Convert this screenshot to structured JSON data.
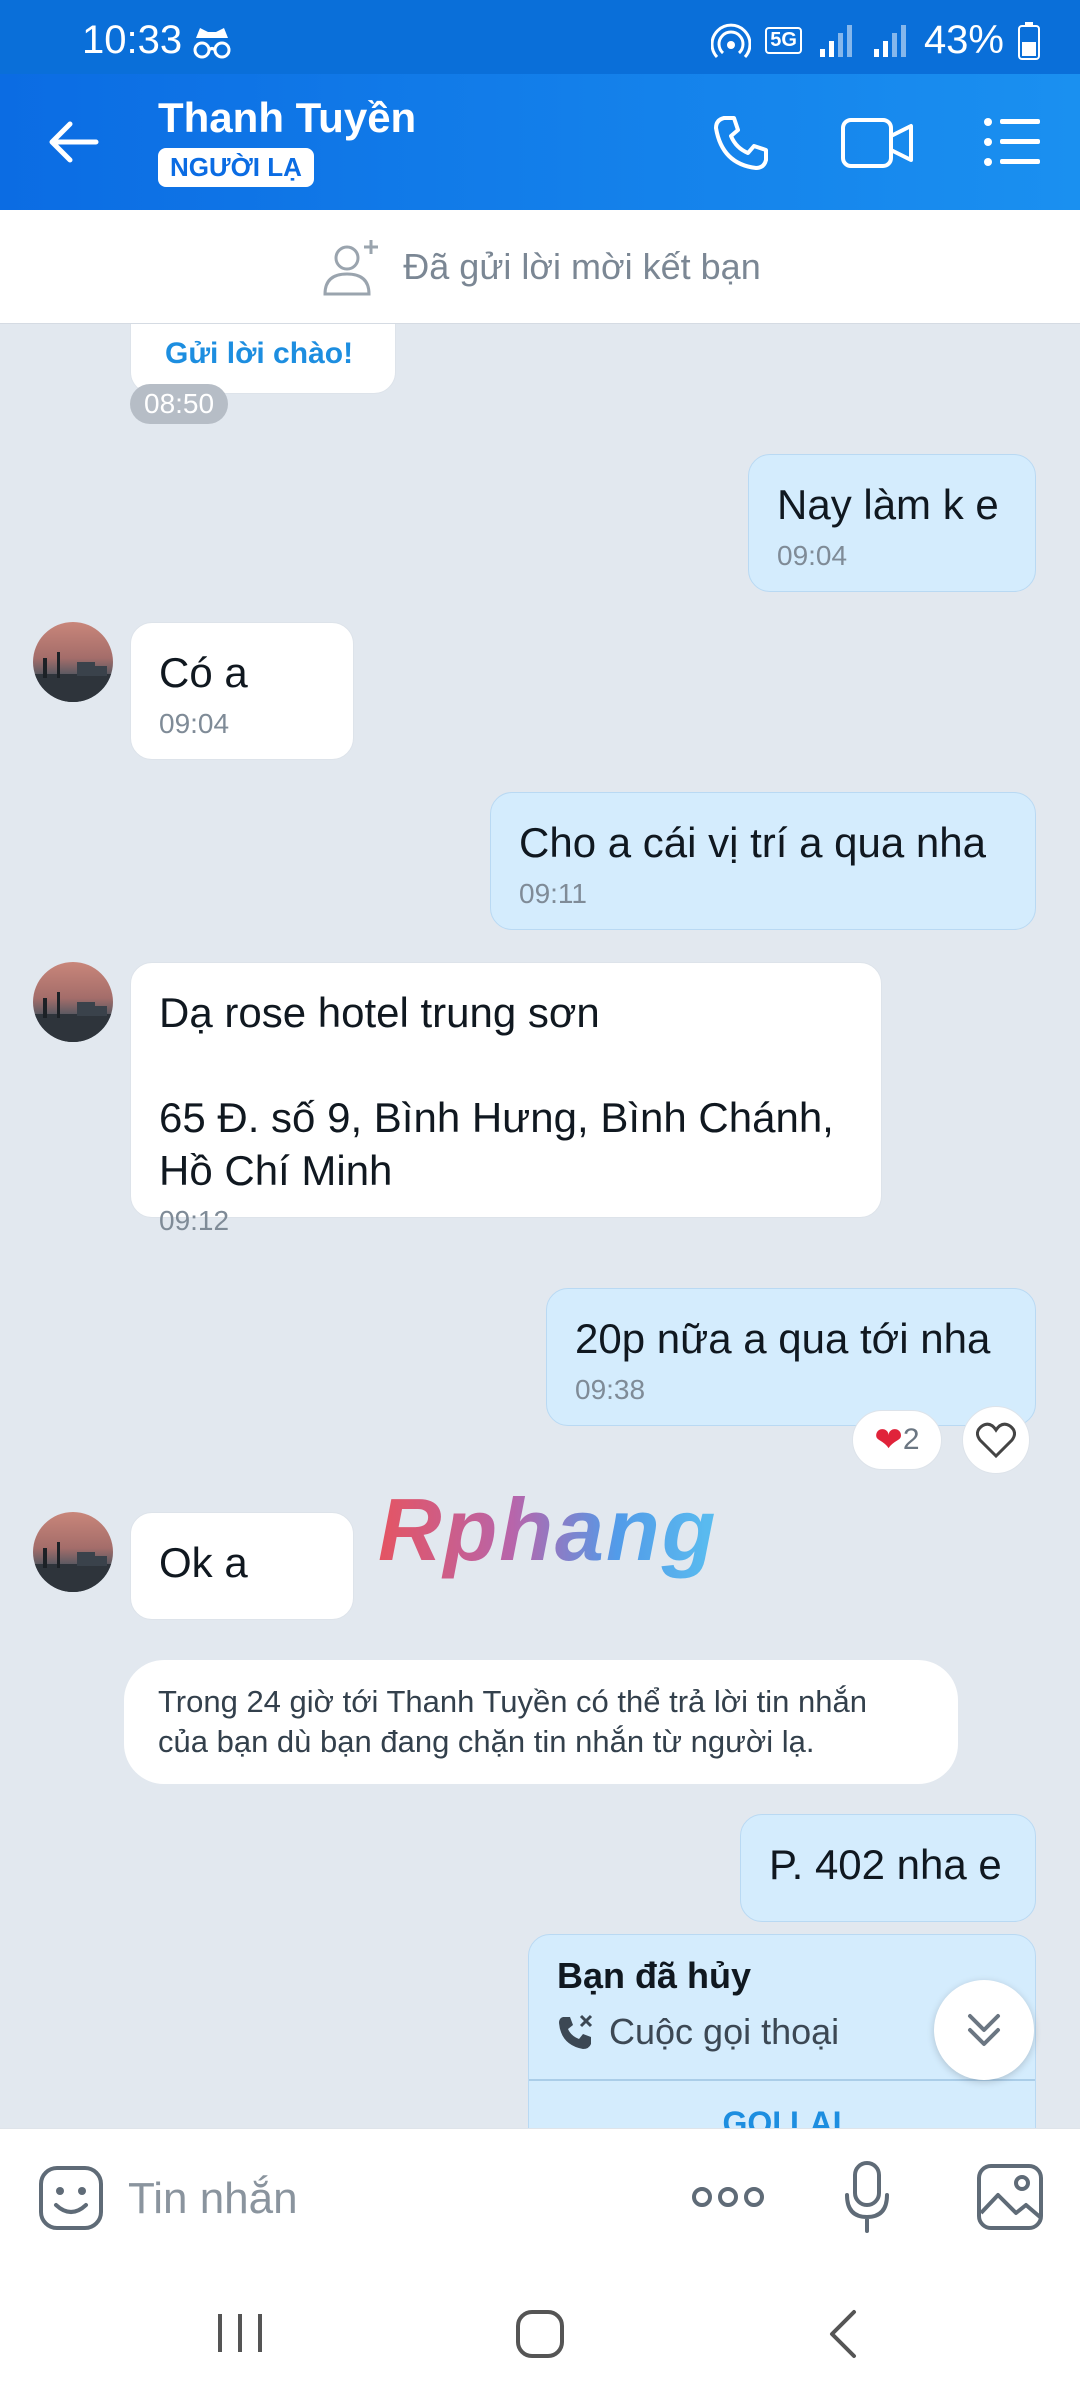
{
  "status_bar": {
    "time": "10:33",
    "battery": "43%",
    "network": "5G"
  },
  "header": {
    "name": "Thanh Tuyền",
    "badge": "NGƯỜI LẠ"
  },
  "friend_request": {
    "text": "Đã gửi lời mời kết bạn"
  },
  "chat": {
    "greeting_label": "Gửi lời chào!",
    "greeting_time": "08:50",
    "messages": [
      {
        "text": "Nay làm k e",
        "time": "09:04"
      },
      {
        "text": "Có a",
        "time": "09:04"
      },
      {
        "text": "Cho a cái vị trí a qua nha",
        "time": "09:11"
      },
      {
        "text": "Dạ rose hotel trung sơn\n\n65 Đ. số 9, Bình Hưng, Bình Chánh, Hồ Chí Minh",
        "time": "09:12"
      },
      {
        "text": "20p nữa a qua tới nha",
        "time": "09:38",
        "reaction_count": "2"
      },
      {
        "text": "Ok a"
      },
      {
        "text": "P. 402 nha e"
      }
    ],
    "notice": "Trong 24 giờ tới Thanh Tuyền có thể trả lời tin nhắn của bạn dù bạn đang chặn tin nhắn từ người lạ.",
    "call_card": {
      "title": "Bạn đã hủy",
      "subtitle": "Cuộc gọi thoại",
      "action": "GỌI LẠI"
    },
    "watermark": "Rphang"
  },
  "input": {
    "placeholder": "Tin nhắn"
  }
}
